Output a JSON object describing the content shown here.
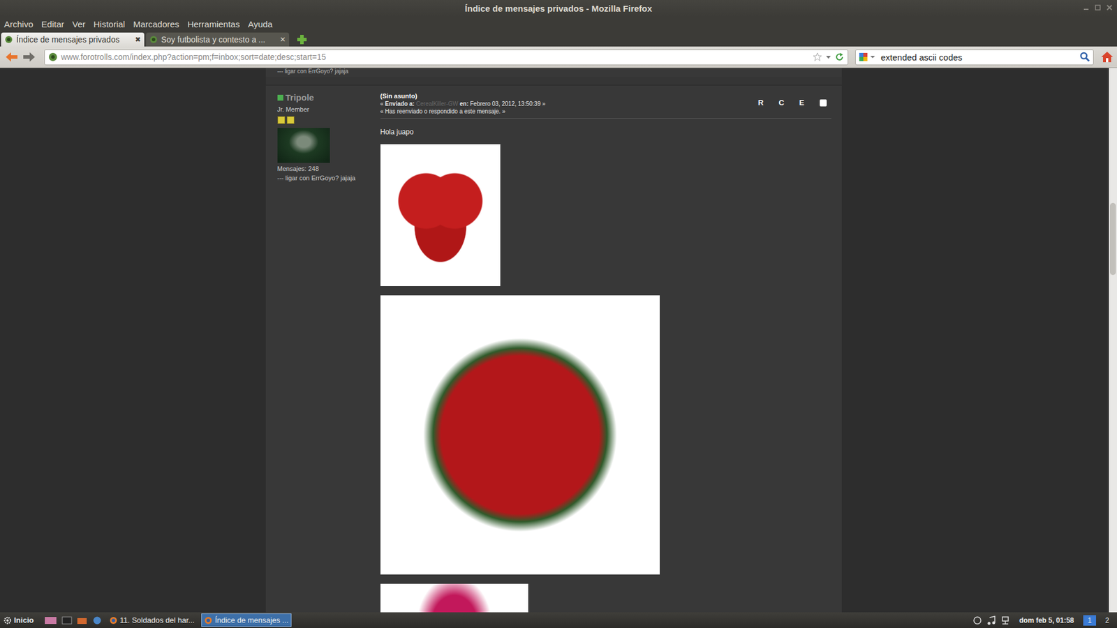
{
  "window": {
    "title": "Índice de mensajes privados - Mozilla Firefox"
  },
  "menu": [
    "Archivo",
    "Editar",
    "Ver",
    "Historial",
    "Marcadores",
    "Herramientas",
    "Ayuda"
  ],
  "tabs": [
    {
      "label": "Índice de mensajes privados",
      "selected": true,
      "close": "✖"
    },
    {
      "label": "Soy futbolista y contesto a ...",
      "selected": false,
      "close": "✕"
    }
  ],
  "address": "www.forotrolls.com/index.php?action=pm;f=inbox;sort=date;desc;start=15",
  "search": {
    "value": "extended ascii codes"
  },
  "page": {
    "prev_signature": "--- ligar con ErrGoyo? jajaja",
    "message": {
      "author": {
        "name": "Tripole",
        "online": true,
        "rank": "Jr. Member",
        "stars": 2,
        "posts": "Mensajes: 248",
        "signature": "--- ligar con ErrGoyo? jajaja"
      },
      "subject": "(Sin asunto)",
      "meta": {
        "open": "«",
        "to_label": "Enviado a:",
        "to": "CerealKiller-GW",
        "on_label": "en:",
        "date": "Febrero 03, 2012, 13:50:39",
        "close": "»"
      },
      "note": "« Has reenviado o respondido a este mensaje. »",
      "actions": [
        "R",
        "C",
        "E"
      ],
      "checked": false,
      "body": "Hola juapo",
      "images": [
        {
          "kind": "heart"
        },
        {
          "kind": "bouquet"
        },
        {
          "kind": "spray"
        }
      ]
    }
  },
  "taskbar": {
    "start": "Inicio",
    "tasks": [
      {
        "label": "11. Soldados del har...",
        "selected": false
      },
      {
        "label": "Índice de mensajes ...",
        "selected": true
      }
    ],
    "clock": "dom feb 5, 01:58",
    "workspaces": [
      {
        "label": "1",
        "selected": true
      },
      {
        "label": "2",
        "selected": false
      }
    ]
  }
}
